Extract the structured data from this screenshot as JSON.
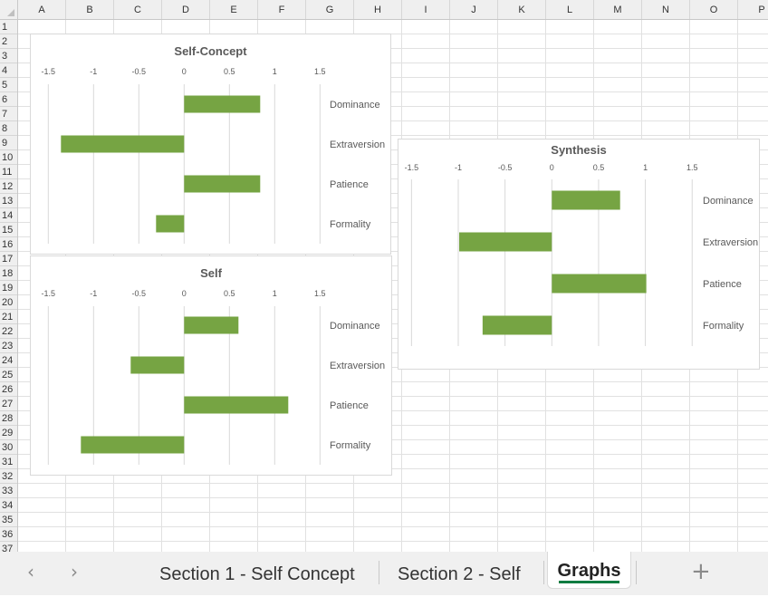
{
  "spreadsheet": {
    "columns": [
      "A",
      "B",
      "C",
      "D",
      "E",
      "F",
      "G",
      "H",
      "I",
      "J",
      "K",
      "L",
      "M",
      "N",
      "O",
      "P"
    ],
    "rows": [
      "1",
      "2",
      "3",
      "4",
      "5",
      "6",
      "7",
      "8",
      "9",
      "10",
      "11",
      "12",
      "13",
      "14",
      "15",
      "16",
      "17",
      "18",
      "19",
      "20",
      "21",
      "22",
      "23",
      "24",
      "25",
      "26",
      "27",
      "28",
      "29",
      "30",
      "31",
      "32",
      "33",
      "34",
      "35",
      "36",
      "37"
    ]
  },
  "colors": {
    "bar": "#76a443",
    "gridline": "#d9d9d9",
    "active_tab_underline": "#107c41"
  },
  "chart_data": [
    {
      "type": "bar",
      "orientation": "horizontal",
      "title": "Self-Concept",
      "categories": [
        "Dominance",
        "Extraversion",
        "Patience",
        "Formality"
      ],
      "values": [
        0.84,
        -1.36,
        0.84,
        -0.31
      ],
      "xlim": [
        -1.5,
        1.5
      ],
      "xticks": [
        "-1.5",
        "-1",
        "-0.5",
        "0",
        "0.5",
        "1",
        "1.5"
      ],
      "xaxis_position": "top",
      "grid": true,
      "legend": "none"
    },
    {
      "type": "bar",
      "orientation": "horizontal",
      "title": "Self",
      "categories": [
        "Dominance",
        "Extraversion",
        "Patience",
        "Formality"
      ],
      "values": [
        0.6,
        -0.59,
        1.15,
        -1.14
      ],
      "xlim": [
        -1.5,
        1.5
      ],
      "xticks": [
        "-1.5",
        "-1",
        "-0.5",
        "0",
        "0.5",
        "1",
        "1.5"
      ],
      "xaxis_position": "top",
      "grid": true,
      "legend": "none"
    },
    {
      "type": "bar",
      "orientation": "horizontal",
      "title": "Synthesis",
      "categories": [
        "Dominance",
        "Extraversion",
        "Patience",
        "Formality"
      ],
      "values": [
        0.73,
        -0.99,
        1.01,
        -0.74
      ],
      "xlim": [
        -1.5,
        1.5
      ],
      "xticks": [
        "-1.5",
        "-1",
        "-0.5",
        "0",
        "0.5",
        "1",
        "1.5"
      ],
      "xaxis_position": "top",
      "grid": true,
      "legend": "none"
    }
  ],
  "tabbar": {
    "prev_icon": "‹",
    "next_icon": "›",
    "tabs": [
      {
        "label": "Section 1 - Self Concept",
        "active": false
      },
      {
        "label": "Section 2 - Self",
        "active": false
      },
      {
        "label": "Graphs",
        "active": true
      }
    ],
    "add_icon": "+"
  }
}
